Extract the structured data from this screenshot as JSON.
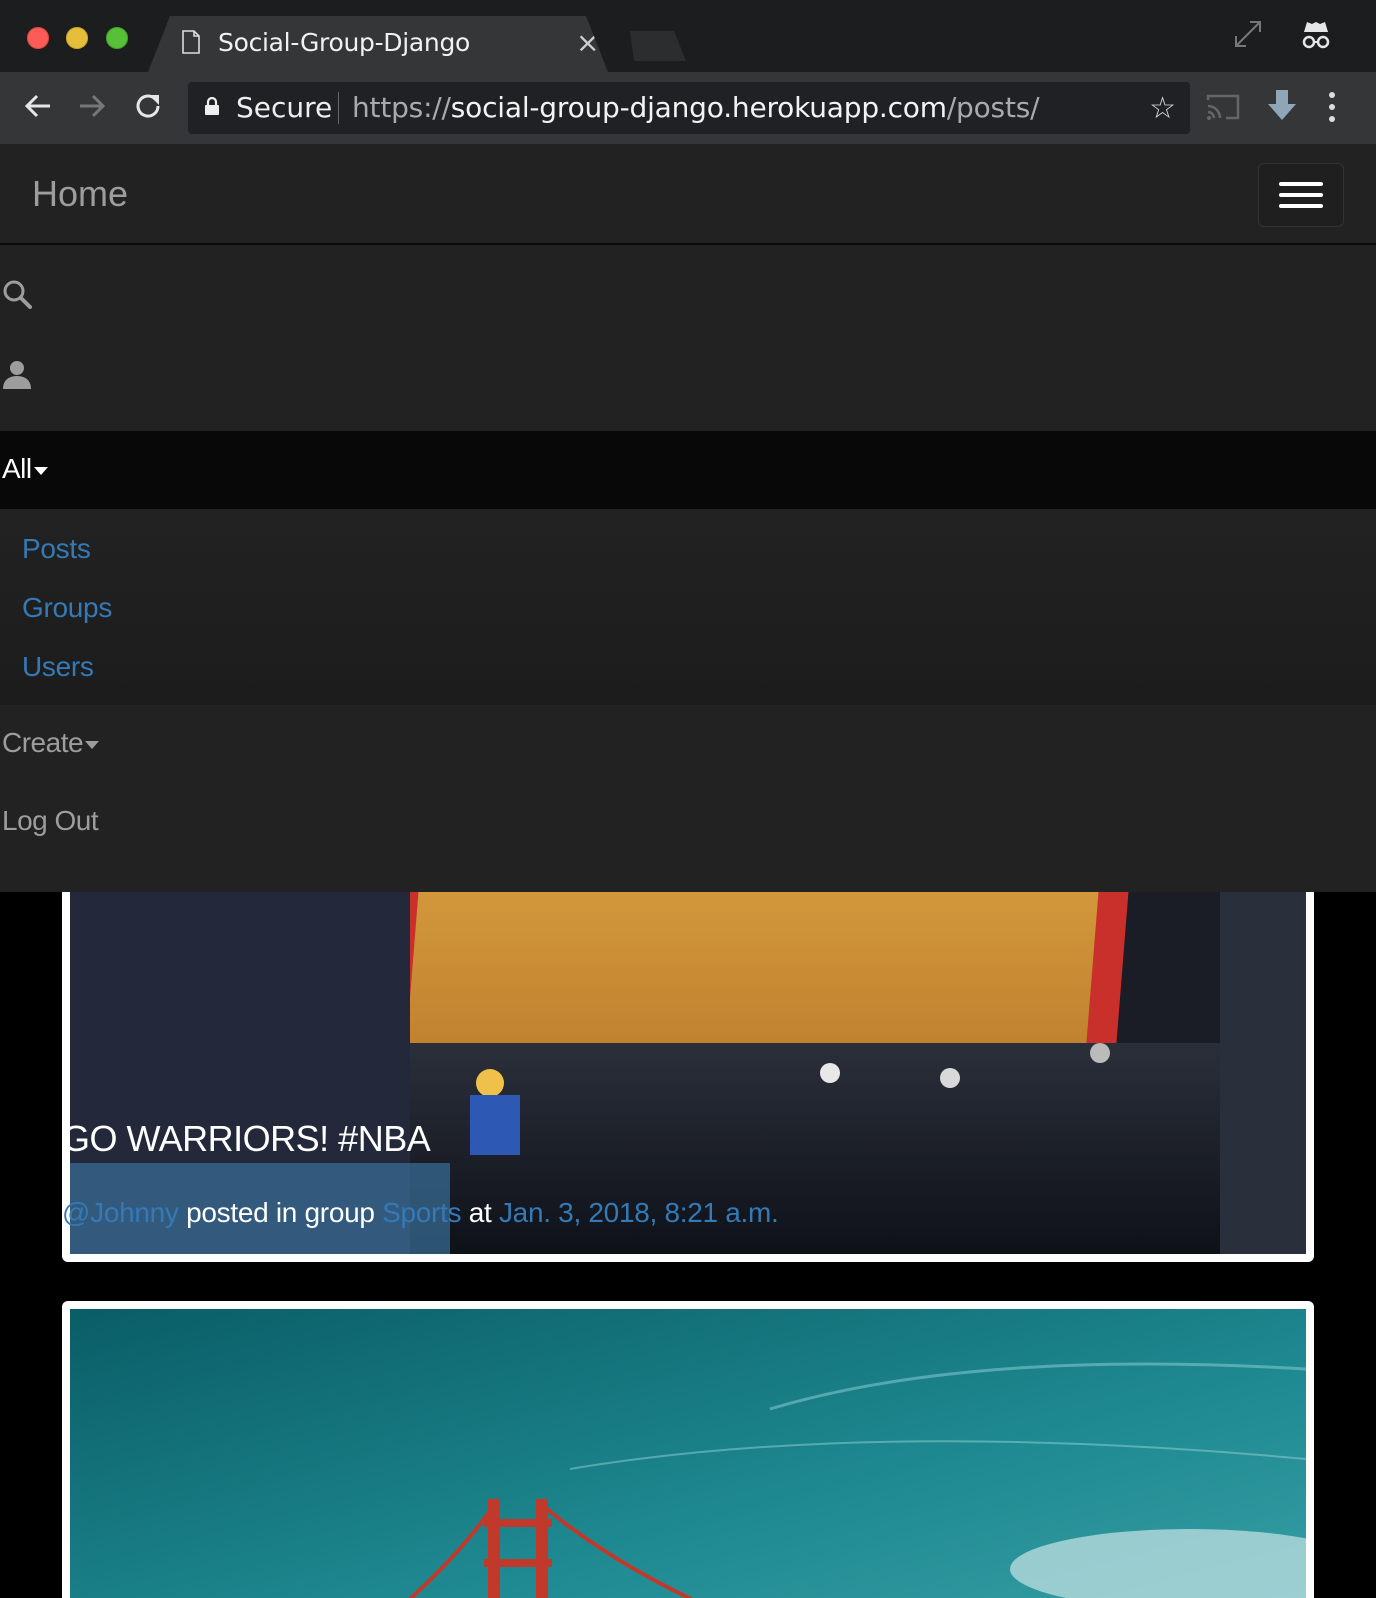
{
  "browser": {
    "tab_title": "Social-Group-Django",
    "tab_close": "×",
    "secure_label": "Secure",
    "url_scheme": "https://",
    "url_host": "social-group-django.herokuapp.com",
    "url_path": "/posts/"
  },
  "navbar": {
    "brand": "Home",
    "menu": {
      "all_label": "All",
      "all_items": [
        "Posts",
        "Groups",
        "Users"
      ],
      "create_label": "Create",
      "logout_label": "Log Out"
    }
  },
  "posts": [
    {
      "title": "GO WARRIORS! #NBA",
      "author": "@Johnny",
      "posted_in_text": " posted in group ",
      "group": "Sports",
      "at_text": " at ",
      "timestamp": "Jan. 3, 2018, 8:21 a.m.",
      "image": "basketball-arena-photo"
    },
    {
      "image": "golden-gate-bridge-photo"
    }
  ],
  "icons": {
    "search": "search-icon",
    "user": "user-icon",
    "hamburger": "hamburger-icon"
  }
}
